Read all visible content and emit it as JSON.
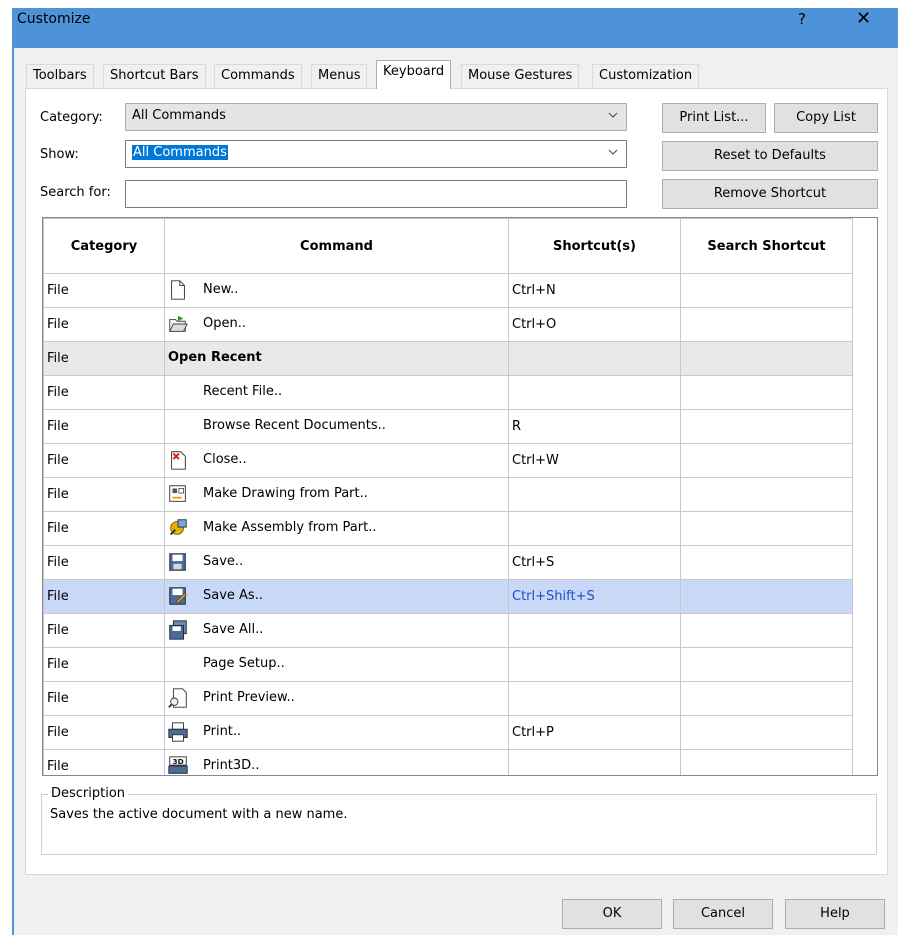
{
  "window": {
    "title": "Customize",
    "help": "?",
    "close": "✕"
  },
  "tabs": [
    "Toolbars",
    "Shortcut Bars",
    "Commands",
    "Menus",
    "Keyboard",
    "Mouse Gestures",
    "Customization"
  ],
  "active_tab": "Keyboard",
  "category": {
    "label": "Category:",
    "value": "All Commands"
  },
  "show": {
    "label": "Show:",
    "value": "All Commands"
  },
  "search": {
    "label": "Search for:",
    "value": ""
  },
  "buttons": {
    "print_list": "Print List...",
    "copy_list": "Copy List",
    "reset": "Reset to Defaults",
    "remove": "Remove Shortcut",
    "ok": "OK",
    "cancel": "Cancel",
    "help": "Help"
  },
  "columns": [
    "Category",
    "Command",
    "Shortcut(s)",
    "Search Shortcut"
  ],
  "rows": [
    {
      "category": "File",
      "icon": "new-document-icon",
      "command": "New..",
      "shortcut": "Ctrl+N",
      "search": ""
    },
    {
      "category": "File",
      "icon": "open-folder-icon",
      "command": "Open..",
      "shortcut": "Ctrl+O",
      "search": ""
    },
    {
      "category": "File",
      "icon": "",
      "command": "Open Recent",
      "shortcut": "",
      "search": ""
    },
    {
      "category": "File",
      "icon": "",
      "command": "Recent File..",
      "shortcut": "",
      "search": ""
    },
    {
      "category": "File",
      "icon": "",
      "command": "Browse Recent Documents..",
      "shortcut": "R",
      "search": ""
    },
    {
      "category": "File",
      "icon": "close-document-icon",
      "command": "Close..",
      "shortcut": "Ctrl+W",
      "search": ""
    },
    {
      "category": "File",
      "icon": "make-drawing-icon",
      "command": "Make Drawing from Part..",
      "shortcut": "",
      "search": ""
    },
    {
      "category": "File",
      "icon": "make-assembly-icon",
      "command": "Make Assembly from Part..",
      "shortcut": "",
      "search": ""
    },
    {
      "category": "File",
      "icon": "save-icon",
      "command": "Save..",
      "shortcut": "Ctrl+S",
      "search": ""
    },
    {
      "category": "File",
      "icon": "save-as-icon",
      "command": "Save As..",
      "shortcut": "Ctrl+Shift+S",
      "search": ""
    },
    {
      "category": "File",
      "icon": "save-all-icon",
      "command": "Save All..",
      "shortcut": "",
      "search": ""
    },
    {
      "category": "File",
      "icon": "",
      "command": "Page Setup..",
      "shortcut": "",
      "search": ""
    },
    {
      "category": "File",
      "icon": "print-preview-icon",
      "command": "Print Preview..",
      "shortcut": "",
      "search": ""
    },
    {
      "category": "File",
      "icon": "print-icon",
      "command": "Print..",
      "shortcut": "Ctrl+P",
      "search": ""
    },
    {
      "category": "File",
      "icon": "print3d-icon",
      "command": "Print3D..",
      "shortcut": "",
      "search": ""
    },
    {
      "category": "File",
      "icon": "",
      "command": "",
      "shortcut": "",
      "search": ""
    }
  ],
  "group_row_index": 2,
  "selected_row_index": 9,
  "description": {
    "legend": "Description",
    "text": "Saves the active document with a new name."
  },
  "colors": {
    "titlebar": "#4e93d9",
    "selection": "#c7d9f7",
    "shortcut_blue": "#1c4cc7"
  }
}
